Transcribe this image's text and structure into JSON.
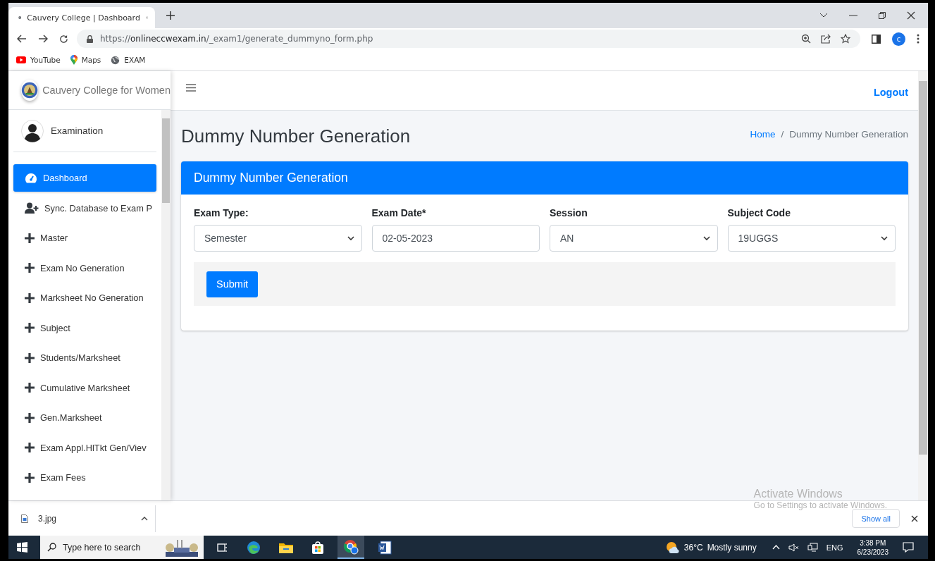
{
  "browser": {
    "tab": {
      "title": "Cauvery College | Dashboard",
      "selected": true
    },
    "url": {
      "scheme": "https://",
      "host": "onlineccwexam.in",
      "path": "/_exam1/generate_dummyno_form.php"
    },
    "profile": "c",
    "bookmarks": [
      {
        "kind": "youtube",
        "label": "YouTube"
      },
      {
        "kind": "maps",
        "label": "Maps"
      },
      {
        "kind": "globe",
        "label": "EXAM"
      }
    ]
  },
  "sidebar": {
    "brand": "Cauvery College for Women",
    "user": "Examination",
    "items": [
      {
        "kind": "dashboard",
        "label": "Dashboard",
        "selected": true
      },
      {
        "kind": "user-plus",
        "label": "Sync. Database to Exam P",
        "selected": false
      },
      {
        "kind": "plus",
        "label": "Master",
        "selected": false
      },
      {
        "kind": "plus",
        "label": "Exam No Generation",
        "selected": false
      },
      {
        "kind": "plus",
        "label": "Marksheet No Generation",
        "selected": false
      },
      {
        "kind": "plus",
        "label": "Subject",
        "selected": false
      },
      {
        "kind": "plus",
        "label": "Students/Marksheet",
        "selected": false
      },
      {
        "kind": "plus",
        "label": "Cumulative Marksheet",
        "selected": false
      },
      {
        "kind": "plus",
        "label": "Gen.Marksheet",
        "selected": false
      },
      {
        "kind": "plus",
        "label": "Exam Appl.HlTkt Gen/Viev",
        "selected": false
      },
      {
        "kind": "plus",
        "label": "Exam Fees",
        "selected": false
      }
    ]
  },
  "topbar": {
    "logout": "Logout"
  },
  "page": {
    "title": "Dummy Number Generation",
    "breadcrumb": [
      "Home",
      "Dummy Number Generation"
    ],
    "breadcrumb_separator": "/"
  },
  "card": {
    "title": "Dummy Number Generation",
    "fields": [
      {
        "kind": "select",
        "label": "Exam Type:",
        "value": "Semester"
      },
      {
        "kind": "text",
        "label": "Exam Date*",
        "value": "02-05-2023"
      },
      {
        "kind": "select",
        "label": "Session",
        "value": "AN"
      },
      {
        "kind": "select",
        "label": "Subject Code",
        "value": "19UGGS"
      }
    ],
    "submit": "Submit"
  },
  "activation": {
    "title": "Activate Windows",
    "hint": "Go to Settings to activate Windows."
  },
  "downloads": {
    "file": "3.jpg",
    "show_all": "Show all"
  },
  "taskbar": {
    "search_placeholder": "Type here to search",
    "weather": {
      "temp": "36°C",
      "text": "Mostly sunny"
    },
    "lang": "ENG",
    "time": "3:38 PM",
    "date": "6/23/2023"
  }
}
